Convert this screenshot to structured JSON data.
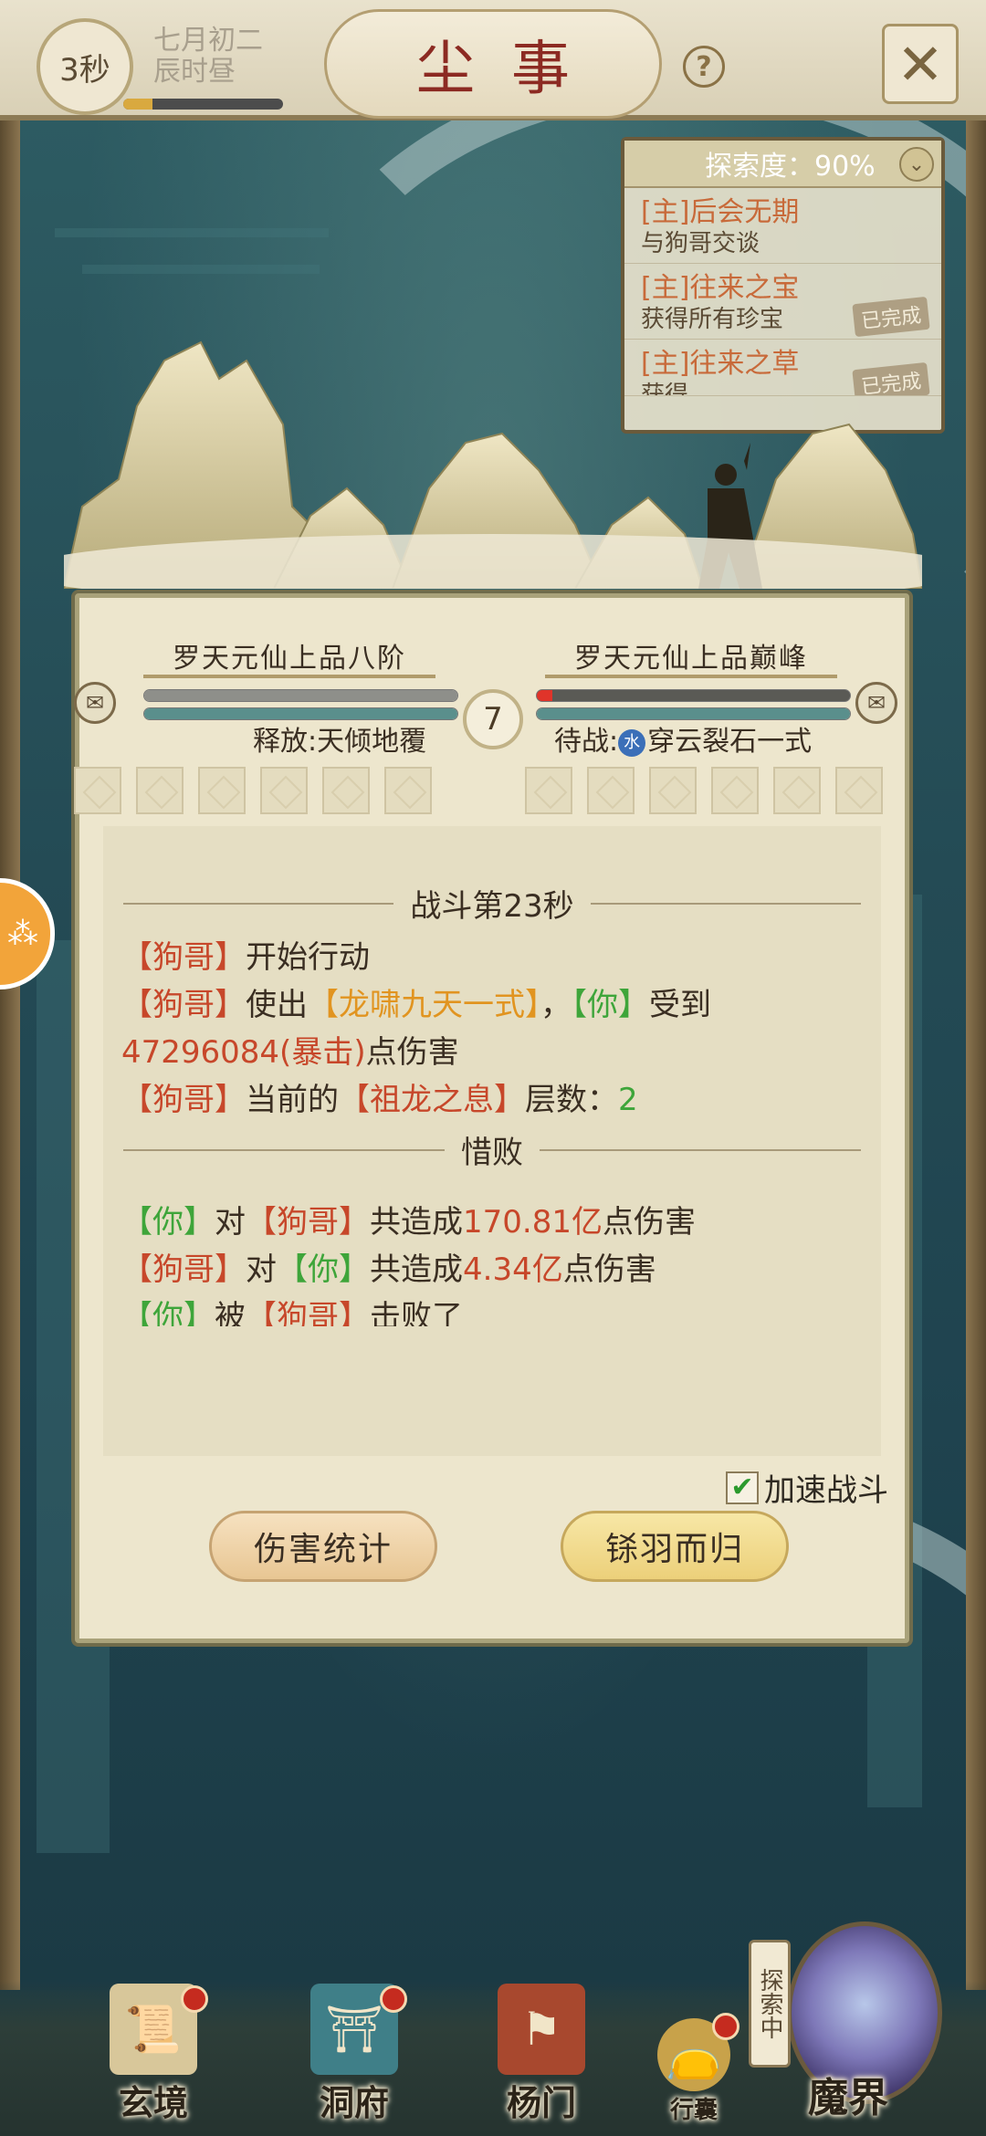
{
  "topbar": {
    "timer": "3秒",
    "date_line1": "七月初二",
    "date_line2": "辰时昼",
    "date_progress": 0.18,
    "title": "尘事",
    "help": "?",
    "close": "✕"
  },
  "quest_panel": {
    "explore_label": "探索度：90%",
    "items": [
      {
        "title": "[主]后会无期",
        "desc": "与狗哥交谈",
        "stamp": ""
      },
      {
        "title": "[主]往来之宝",
        "desc": "获得所有珍宝",
        "stamp": "已完成"
      },
      {
        "title": "[主]往来之草",
        "desc": "获得…",
        "stamp": "已完成"
      }
    ]
  },
  "battle": {
    "left_name": "罗天元仙上品八阶",
    "right_name": "罗天元仙上品巅峰",
    "left_hp": 1.0,
    "left_mp": 1.0,
    "right_hp": 0.05,
    "right_mp": 1.0,
    "round_number": "7",
    "left_skill": "释放:天倾地覆",
    "right_skill_prefix": "待战:",
    "right_skill_element": "水",
    "right_skill_name": "穿云裂石一式",
    "time_divider": "战斗第23秒",
    "log": {
      "l1_name": "【狗哥】",
      "l1_text": "开始行动",
      "l2_name": "【狗哥】",
      "l2_text1": "使出",
      "l2_skill": "【龙啸九天一式】",
      "l2_comma": "，",
      "l2_target": "【你】",
      "l2_text2": "受到",
      "l3_damage": "47296084(暴击)",
      "l3_text": "点伤害",
      "l4_name": "【狗哥】",
      "l4_text1": "当前的",
      "l4_buff": "【祖龙之息】",
      "l4_text2": "层数：",
      "l4_count": "2"
    },
    "result_divider": "惜败",
    "summary": {
      "s1_you": "【你】",
      "s1_to": "对",
      "s1_enemy": "【狗哥】",
      "s1_text1": "共造成",
      "s1_value": "170.81亿",
      "s1_text2": "点伤害",
      "s2_enemy": "【狗哥】",
      "s2_to": "对",
      "s2_you": "【你】",
      "s2_text1": "共造成",
      "s2_value": "4.34亿",
      "s2_text2": "点伤害",
      "s3_you": "【你】",
      "s3_by": "被",
      "s3_enemy": "【狗哥】",
      "s3_text": "击败了"
    },
    "speed_label": "加速战斗",
    "speed_checked": "✔",
    "btn_stats": "伤害统计",
    "btn_return": "铩羽而归"
  },
  "nav": {
    "items": [
      {
        "label": "玄境",
        "icon": "scroll-icon"
      },
      {
        "label": "洞府",
        "icon": "pavilion-icon"
      },
      {
        "label": "杨门",
        "icon": "banner-icon"
      },
      {
        "label": "行囊",
        "icon": "bag-icon"
      },
      {
        "label": "魔界",
        "icon": "portal-icon"
      }
    ],
    "explore_tag": "探索中"
  },
  "colors": {
    "damage_red": "#c7472a",
    "skill_orange": "#e19420",
    "ally_green": "#3ea53a",
    "title_red": "#8c2a22"
  }
}
